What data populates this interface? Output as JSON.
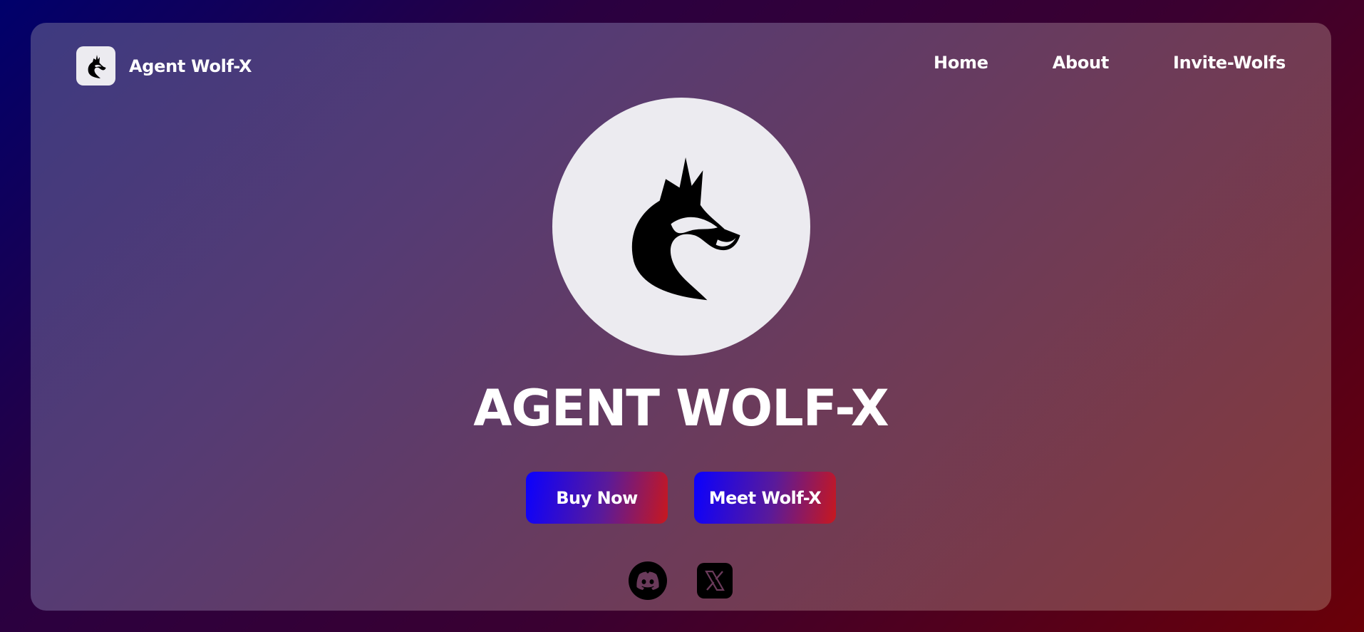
{
  "brand": {
    "name": "Agent Wolf-X",
    "logo_icon": "wolf-head-icon"
  },
  "nav": {
    "items": [
      {
        "label": "Home"
      },
      {
        "label": "About"
      },
      {
        "label": "Invite-Wolfs"
      }
    ]
  },
  "hero": {
    "avatar_icon": "wolf-head-icon",
    "title": "AGENT WOLF-X",
    "buttons": {
      "buy_label": "Buy Now",
      "meet_label": "Meet Wolf-X"
    }
  },
  "social": {
    "icons": [
      "discord-icon",
      "x-icon"
    ]
  },
  "colors": {
    "button_gradient_start": "#0a00ff",
    "button_gradient_end": "#c8181e",
    "panel_overlay": "#553b74",
    "avatar_bg": "#ecebf0"
  }
}
